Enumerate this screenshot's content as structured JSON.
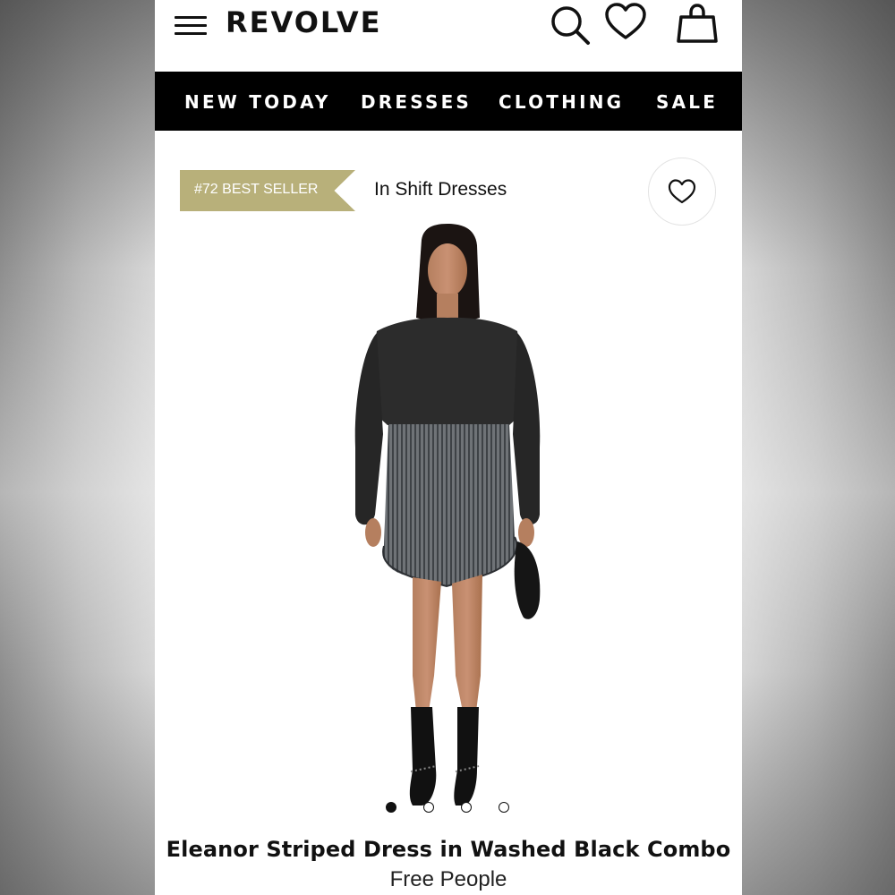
{
  "header": {
    "logo": "REVOLVE",
    "icons": [
      "menu-icon",
      "search-icon",
      "heart-icon",
      "shopping-bag-icon"
    ]
  },
  "nav": {
    "items": [
      "NEW TODAY",
      "DRESSES",
      "CLOTHING",
      "SALE"
    ]
  },
  "badge": {
    "text": "#72 BEST SELLER",
    "color": "#b8b07a"
  },
  "category": {
    "text": "In Shift Dresses"
  },
  "carousel": {
    "count": 4,
    "active_index": 0
  },
  "product": {
    "title": "Eleanor Striped Dress in Washed Black Combo",
    "brand": "Free People"
  },
  "colors": {
    "nav_bg": "#000000",
    "text": "#111111",
    "badge": "#b8b07a"
  }
}
